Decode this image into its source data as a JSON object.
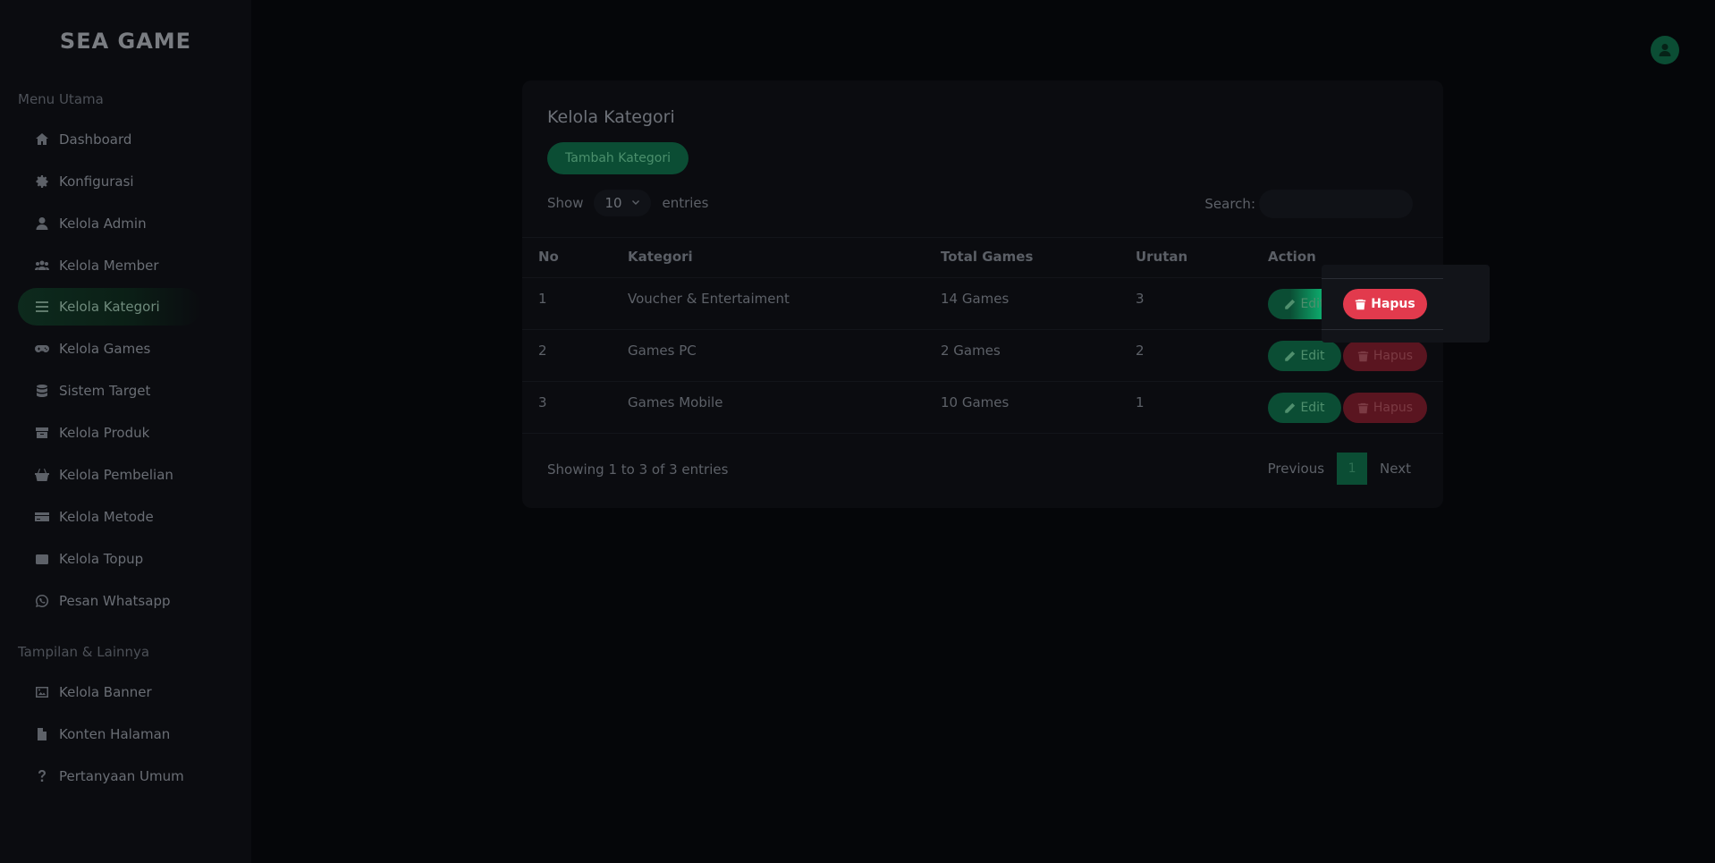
{
  "app": {
    "logo_text": "SEA GAME"
  },
  "sidebar": {
    "section_main": "Menu Utama",
    "main_items": [
      {
        "label": "Dashboard",
        "icon": "home-icon"
      },
      {
        "label": "Konfigurasi",
        "icon": "gear-icon"
      },
      {
        "label": "Kelola Admin",
        "icon": "user-icon"
      },
      {
        "label": "Kelola Member",
        "icon": "users-icon"
      },
      {
        "label": "Kelola Kategori",
        "icon": "list-icon",
        "active": true
      },
      {
        "label": "Kelola Games",
        "icon": "gamepad-icon"
      },
      {
        "label": "Sistem Target",
        "icon": "database-icon"
      },
      {
        "label": "Kelola Produk",
        "icon": "box-icon"
      },
      {
        "label": "Kelola Pembelian",
        "icon": "basket-icon"
      },
      {
        "label": "Kelola Metode",
        "icon": "credit-card-icon"
      },
      {
        "label": "Kelola Topup",
        "icon": "wallet-icon"
      },
      {
        "label": "Pesan Whatsapp",
        "icon": "whatsapp-icon"
      }
    ],
    "section_other": "Tampilan & Lainnya",
    "other_items": [
      {
        "label": "Kelola Banner",
        "icon": "image-icon"
      },
      {
        "label": "Konten Halaman",
        "icon": "file-icon"
      },
      {
        "label": "Pertanyaan Umum",
        "icon": "question-icon"
      }
    ]
  },
  "main": {
    "title": "Kelola Kategori",
    "add_button": "Tambah Kategori",
    "show_label": "Show",
    "entries_value": "10",
    "entries_label": "entries",
    "search_label": "Search:",
    "search_value": "",
    "columns": [
      "No",
      "Kategori",
      "Total Games",
      "Urutan",
      "Action"
    ],
    "rows": [
      {
        "no": "1",
        "kategori": "Voucher & Entertaiment",
        "total": "14 Games",
        "urutan": "3"
      },
      {
        "no": "2",
        "kategori": "Games PC",
        "total": "2 Games",
        "urutan": "2"
      },
      {
        "no": "3",
        "kategori": "Games Mobile",
        "total": "10 Games",
        "urutan": "1"
      }
    ],
    "edit_label": "Edit",
    "delete_label": "Hapus",
    "showing_text": "Showing 1 to 3 of 3 entries",
    "prev_label": "Previous",
    "page_current": "1",
    "next_label": "Next"
  },
  "colors": {
    "accent_green": "#0b4d34",
    "highlight_green": "#0fe38f",
    "danger_red": "#e23a4d"
  }
}
